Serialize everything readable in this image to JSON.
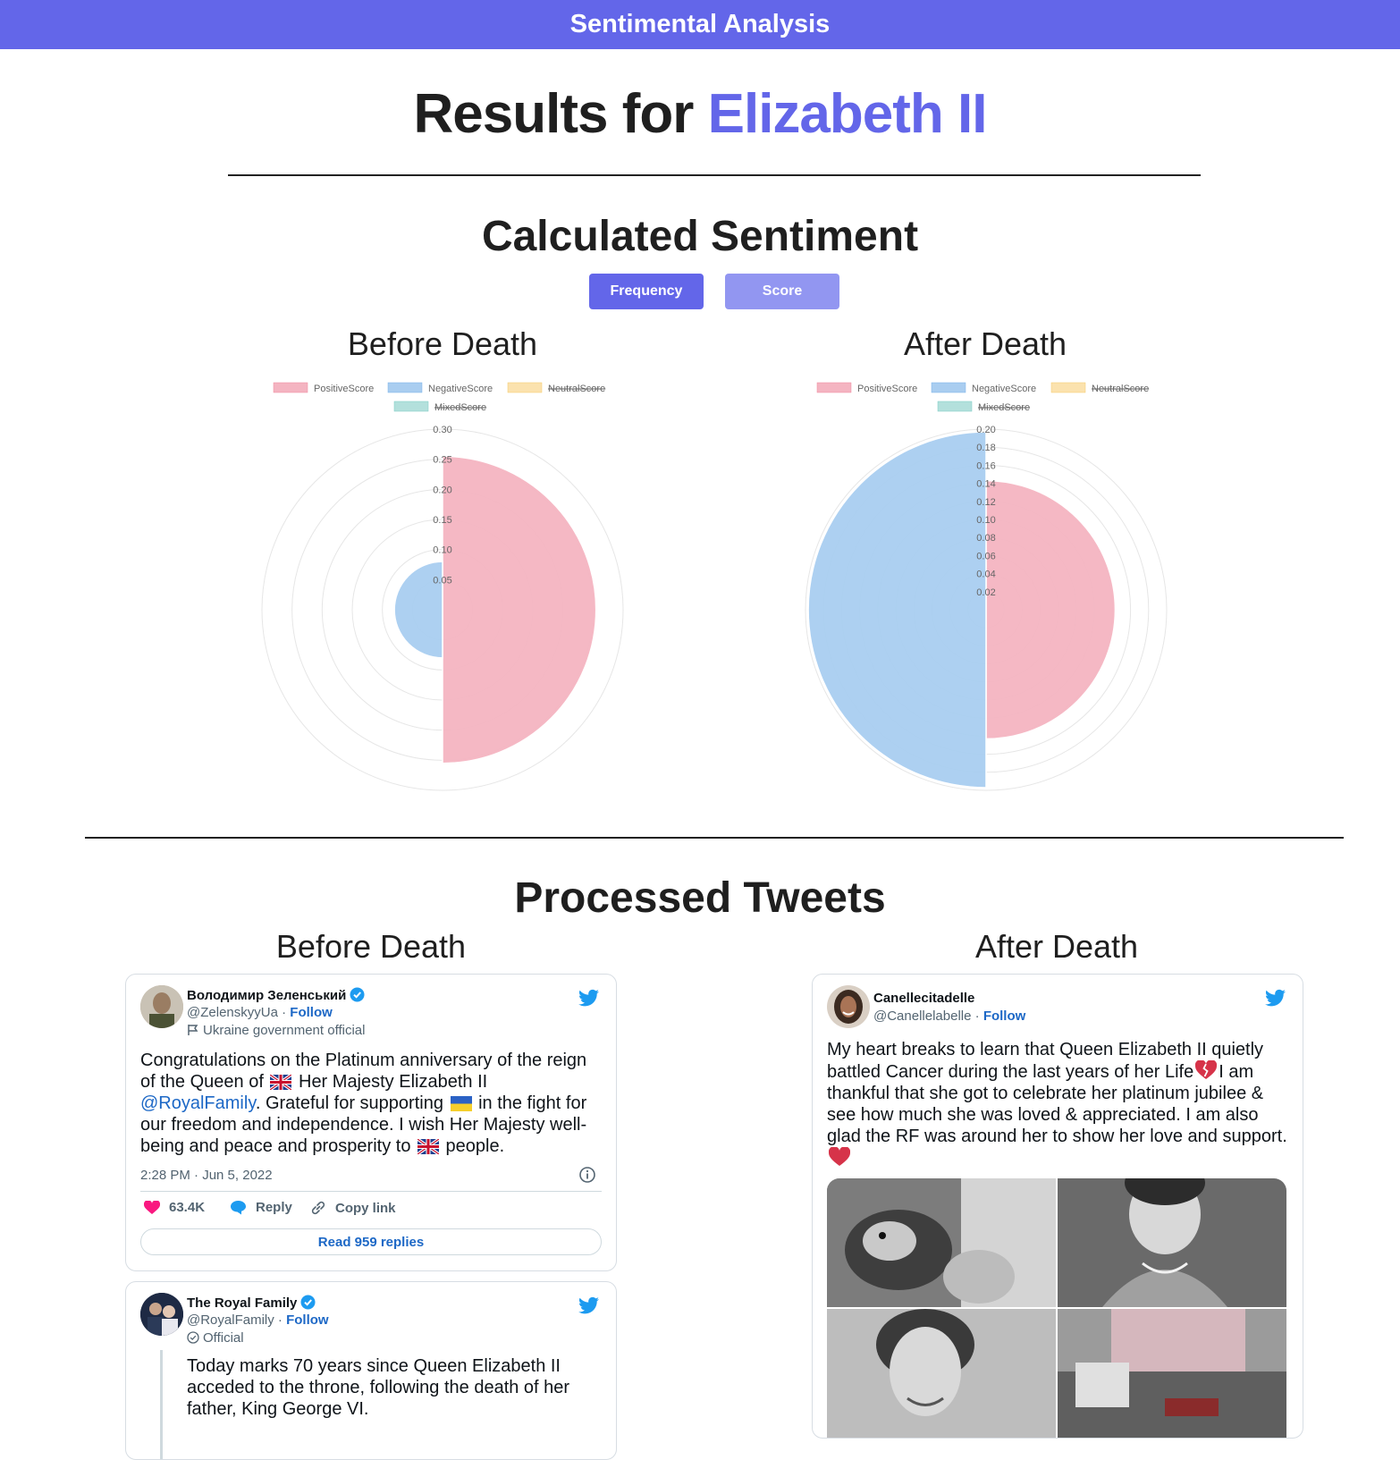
{
  "app": {
    "title": "Sentimental Analysis"
  },
  "header": {
    "results_prefix": "Results for",
    "subject": "Elizabeth II"
  },
  "calculated": {
    "title": "Calculated Sentiment",
    "buttons": {
      "frequency": "Frequency",
      "score": "Score"
    },
    "before_title": "Before Death",
    "after_title": "After Death"
  },
  "colors": {
    "accent": "#6366e9",
    "positive": "#f4b4c1",
    "negative": "#a9cdf0",
    "neutral": "#fbe2ae",
    "mixed": "#b3e0dc"
  },
  "chart_data": [
    {
      "type": "polarArea",
      "title": "Before Death",
      "legend": [
        {
          "label": "PositiveScore",
          "hidden": false
        },
        {
          "label": "NegativeScore",
          "hidden": false
        },
        {
          "label": "NeutralScore",
          "hidden": true
        },
        {
          "label": "MixedScore",
          "hidden": true
        }
      ],
      "legend_position": "top",
      "values": {
        "PositiveScore": 0.255,
        "NegativeScore": 0.08
      },
      "rmax": 0.3,
      "ticks": [
        "0.05",
        "0.10",
        "0.15",
        "0.20",
        "0.25",
        "0.30"
      ]
    },
    {
      "type": "polarArea",
      "title": "After Death",
      "legend": [
        {
          "label": "PositiveScore",
          "hidden": false
        },
        {
          "label": "NegativeScore",
          "hidden": false
        },
        {
          "label": "NeutralScore",
          "hidden": true
        },
        {
          "label": "MixedScore",
          "hidden": true
        }
      ],
      "legend_position": "top",
      "values": {
        "PositiveScore": 0.143,
        "NegativeScore": 0.197
      },
      "rmax": 0.2,
      "ticks": [
        "0.02",
        "0.04",
        "0.06",
        "0.08",
        "0.10",
        "0.12",
        "0.14",
        "0.16",
        "0.18",
        "0.20"
      ]
    }
  ],
  "processed": {
    "title": "Processed Tweets",
    "before_title": "Before Death",
    "after_title": "After Death",
    "before_tweets": [
      {
        "name": "Володимир Зеленський",
        "handle": "@ZelenskyyUa",
        "sep": "·",
        "follow": "Follow",
        "label": "Ukraine government official",
        "text_1": "Congratulations on the Platinum anniversary of the reign of the Queen of ",
        "text_2": " Her Majesty Elizabeth II ",
        "mention": "@RoyalFamily",
        "text_3": ". Grateful for supporting ",
        "text_4": " in the fight for our freedom and independence. I wish Her Majesty well-being and peace and prosperity to ",
        "text_5": " people.",
        "time": "2:28 PM · Jun 5, 2022",
        "likes": "63.4K",
        "reply": "Reply",
        "copy": "Copy link",
        "read_replies": "Read 959 replies"
      },
      {
        "name": "The Royal Family",
        "handle": "@RoyalFamily",
        "sep": "·",
        "follow": "Follow",
        "label": "Official",
        "text": "Today marks 70 years since Queen Elizabeth II acceded to the throne, following the death of her father, King George VI."
      }
    ],
    "after_tweets": [
      {
        "name": "Canellecitadelle",
        "handle": "@Canellelabelle",
        "sep": "·",
        "follow": "Follow",
        "text_1": "My heart breaks to learn that Queen Elizabeth II quietly battled Cancer during the last years of her Life",
        "text_2": "I am thankful that she got to celebrate her platinum jubilee & see how much she was loved & appreciated. I am also glad the RF was around her to show her love and support."
      }
    ]
  }
}
